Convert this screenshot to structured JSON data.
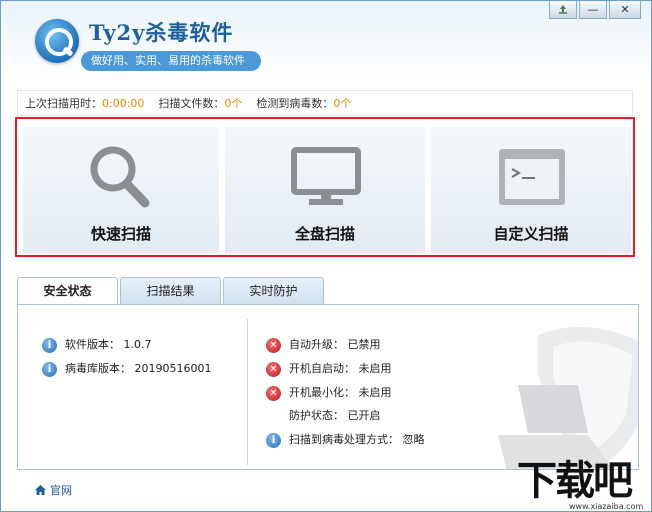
{
  "header": {
    "app_title": "Ty2y杀毒软件",
    "slogan": "做好用、实用、易用的杀毒软件",
    "buttons": {
      "restore": "♻",
      "minimize": "—",
      "close": "✕"
    }
  },
  "stats": {
    "last_scan_label": "上次扫描用时：",
    "last_scan_value": "0:00:00",
    "files_label": "扫描文件数：",
    "files_value": "0个",
    "virus_label": "检测到病毒数：",
    "virus_value": "0个"
  },
  "scan_buttons": {
    "quick": "快速扫描",
    "full": "全盘扫描",
    "custom": "自定义扫描"
  },
  "tabs": [
    "安全状态",
    "扫描结果",
    "实时防护"
  ],
  "status_left": [
    {
      "icon": "info-icon",
      "text": "软件版本：  1.0.7"
    },
    {
      "icon": "info-icon",
      "text": "病毒库版本：  20190516001"
    }
  ],
  "status_right": [
    {
      "icon": "error-icon",
      "text": "自动升级：  已禁用"
    },
    {
      "icon": "error-icon",
      "text": "开机自启动：  未启用"
    },
    {
      "icon": "error-icon",
      "text": "开机最小化：  未启用"
    },
    {
      "icon": "none",
      "text": "防护状态：  已开启"
    },
    {
      "icon": "info-icon",
      "text": "扫描到病毒处理方式：  忽略"
    }
  ],
  "footer": {
    "home_link": "官网"
  },
  "watermark": {
    "big": "下载吧",
    "small": "www.xiazaiba.com"
  },
  "colors": {
    "accent": "#1d5f9e",
    "highlight_border": "#e01e24",
    "stat_value": "#e28a00"
  }
}
